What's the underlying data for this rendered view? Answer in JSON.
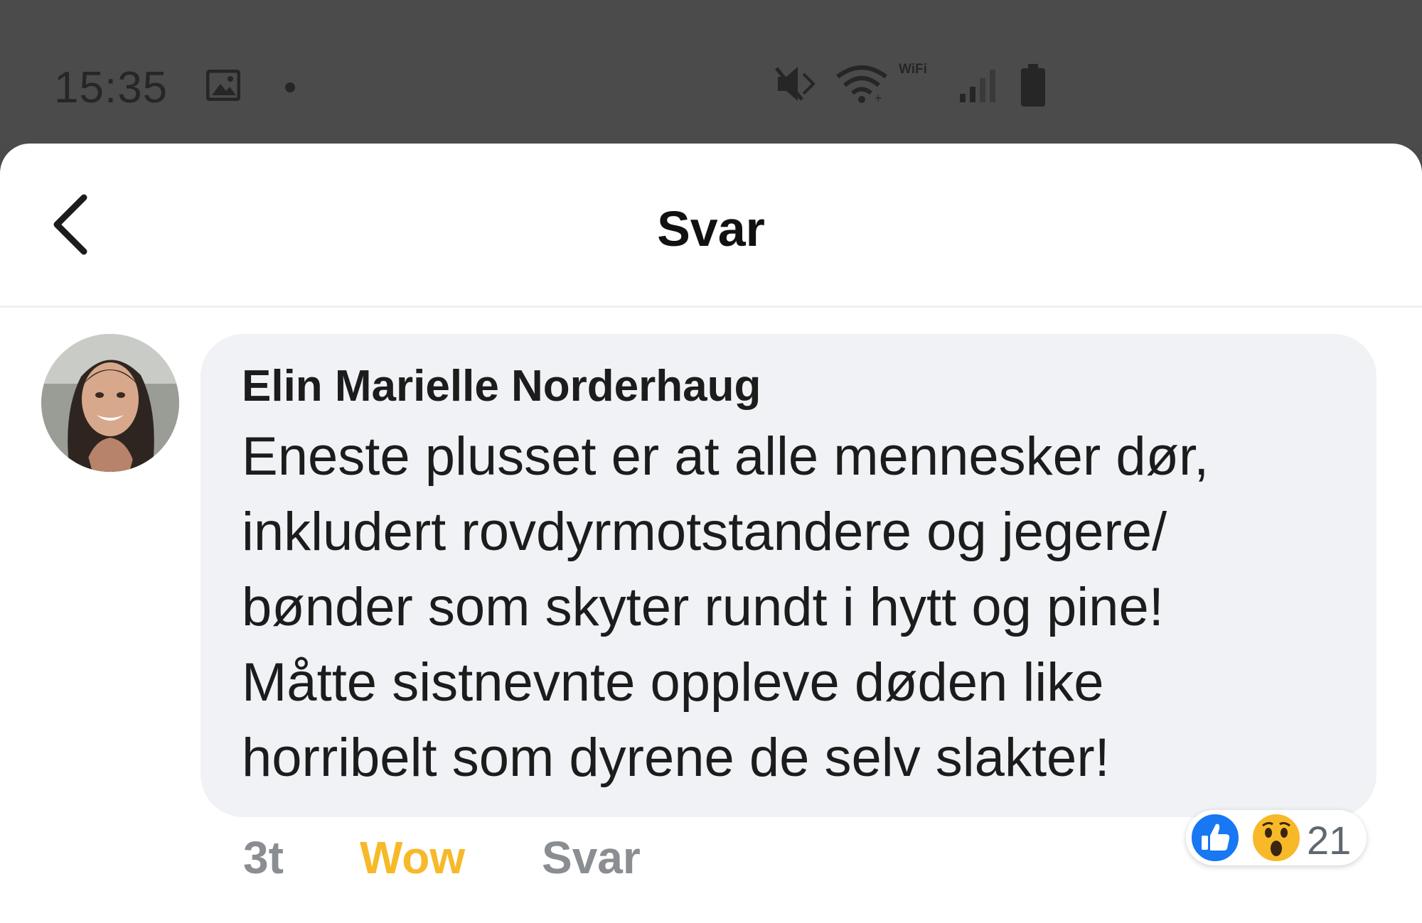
{
  "status_bar": {
    "time": "15:35",
    "wifi_call_label": "WiFi",
    "icons": [
      "image-icon",
      "dot-icon",
      "mute-icon",
      "wifi-icon",
      "signal-icon",
      "battery-icon"
    ]
  },
  "header": {
    "title": "Svar",
    "back_icon": "chevron-left-icon"
  },
  "comment": {
    "author": "Elin Marielle Norderhaug",
    "lines": [
      "Eneste plusset er at alle mennesker dør,",
      "inkludert rovdyrmotstandere og jegere/",
      "bønder som skyter rundt i hytt og pine!",
      "Måtte sistnevnte oppleve døden like",
      "horribelt som dyrene de selv slakter!"
    ],
    "reactions": {
      "types": [
        "like",
        "wow"
      ],
      "count": "21"
    },
    "actions": {
      "time": "3t",
      "reaction_label": "Wow",
      "reply_label": "Svar"
    }
  },
  "colors": {
    "status_bar_bg": "#4b4b4b",
    "bubble_bg": "#f0f2f5",
    "wow_yellow": "#f7b928",
    "like_blue": "#1877f2",
    "muted_text": "#8a8d91"
  }
}
